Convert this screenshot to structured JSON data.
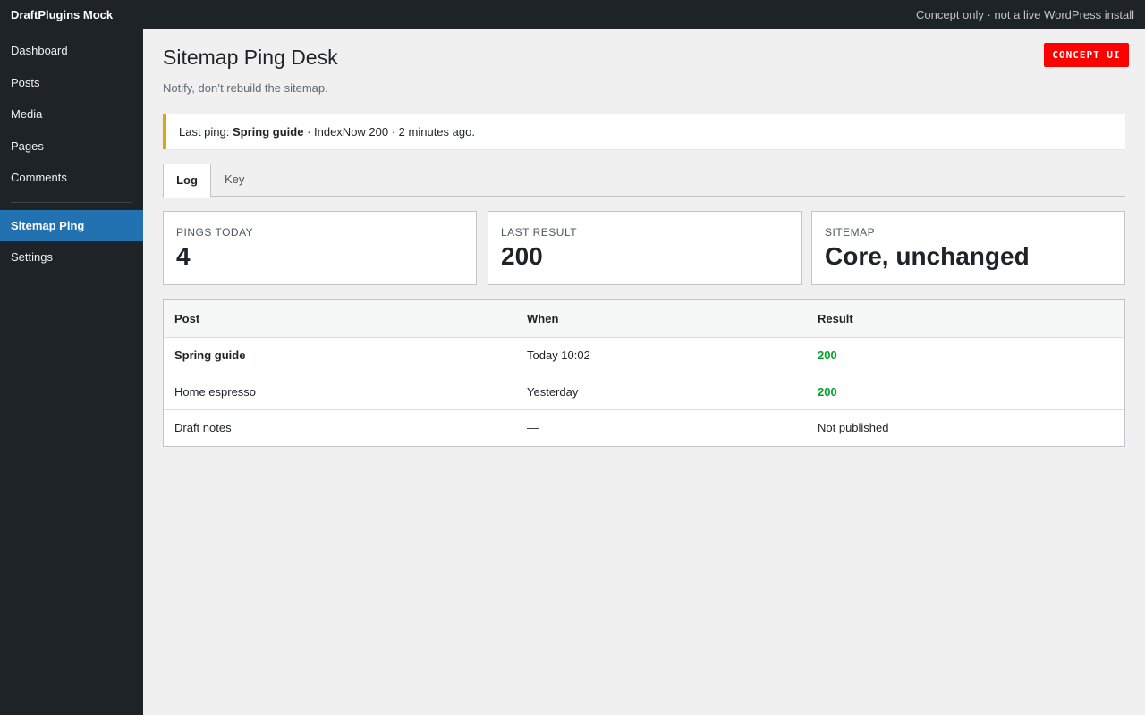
{
  "topbar": {
    "brand": "DraftPlugins Mock",
    "note": "Concept only · not a live WordPress install"
  },
  "sidebar": {
    "items": [
      {
        "label": "Dashboard"
      },
      {
        "label": "Posts"
      },
      {
        "label": "Media"
      },
      {
        "label": "Pages"
      },
      {
        "label": "Comments"
      }
    ],
    "plugin_items": [
      {
        "label": "Sitemap Ping",
        "active": true
      },
      {
        "label": "Settings"
      }
    ]
  },
  "page": {
    "title": "Sitemap Ping Desk",
    "subtitle": "Notify, don’t rebuild the sitemap.",
    "badge": "CONCEPT UI"
  },
  "notice": {
    "prefix": "Last ping: ",
    "post": "Spring guide",
    "suffix": " · IndexNow 200 · 2 minutes ago."
  },
  "tabs": [
    {
      "label": "Log",
      "active": true
    },
    {
      "label": "Key",
      "active": false
    }
  ],
  "cards": [
    {
      "label": "Pings today",
      "value": "4"
    },
    {
      "label": "Last result",
      "value": "200"
    },
    {
      "label": "Sitemap",
      "value": "Core, unchanged"
    }
  ],
  "table": {
    "headers": [
      "Post",
      "When",
      "Result"
    ],
    "rows": [
      {
        "post": "Spring guide",
        "when": "Today 10:02",
        "result": "200"
      },
      {
        "post": "Home espresso",
        "when": "Yesterday",
        "result": "200"
      },
      {
        "post": "Draft notes",
        "when": "—",
        "result": "Not published"
      }
    ]
  },
  "colors": {
    "accent": "#2271b1",
    "notice_border": "#dba617",
    "success": "#00a32a",
    "badge": "#ff0000",
    "admin_dark": "#1d2327"
  }
}
